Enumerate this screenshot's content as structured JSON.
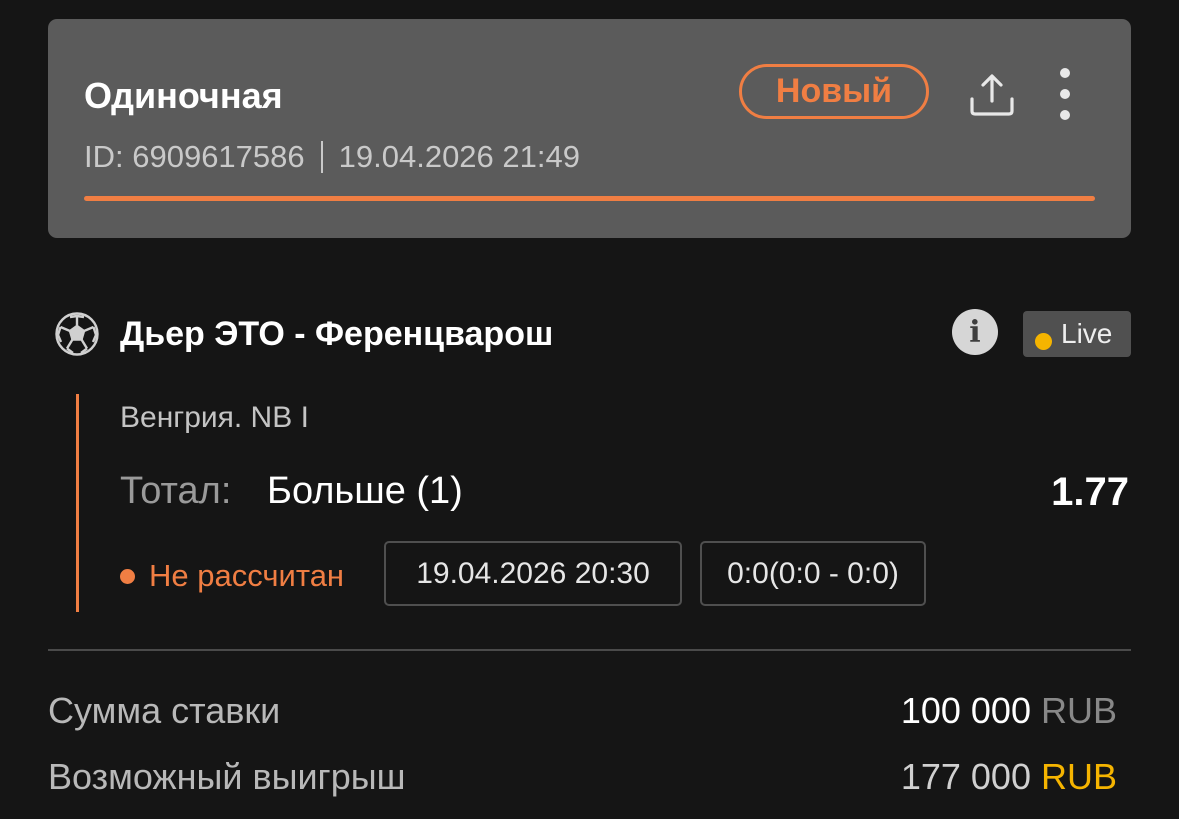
{
  "header": {
    "bet_type": "Одиночная",
    "id_label": "ID: 6909617586",
    "datetime": "19.04.2026 21:49",
    "status_badge": "Новый",
    "share_icon": "share-icon",
    "more_icon": "more-vertical-icon",
    "progress_fraction": 1.0
  },
  "event": {
    "sport_icon": "soccer-ball-icon",
    "title": "Дьер ЭТО - Ференцварош",
    "info_icon": "info-icon",
    "live_label": "Live",
    "league": "Венгрия. NB I",
    "market_label": "Тотал:",
    "market_value": "Больше (1)",
    "odds": "1.77",
    "settlement_status": "Не рассчитан",
    "start_datetime": "19.04.2026 20:30",
    "score": "0:0(0:0 - 0:0)"
  },
  "summary": {
    "stake_label": "Сумма ставки",
    "stake_amount": "100 000",
    "stake_currency": "RUB",
    "win_label": "Возможный выигрыш",
    "win_amount": "177 000",
    "win_currency": "RUB"
  },
  "colors": {
    "accent": "#f07e43",
    "live_dot": "#f5b400",
    "card_bg": "#5b5b5b",
    "page_bg": "#151515"
  }
}
